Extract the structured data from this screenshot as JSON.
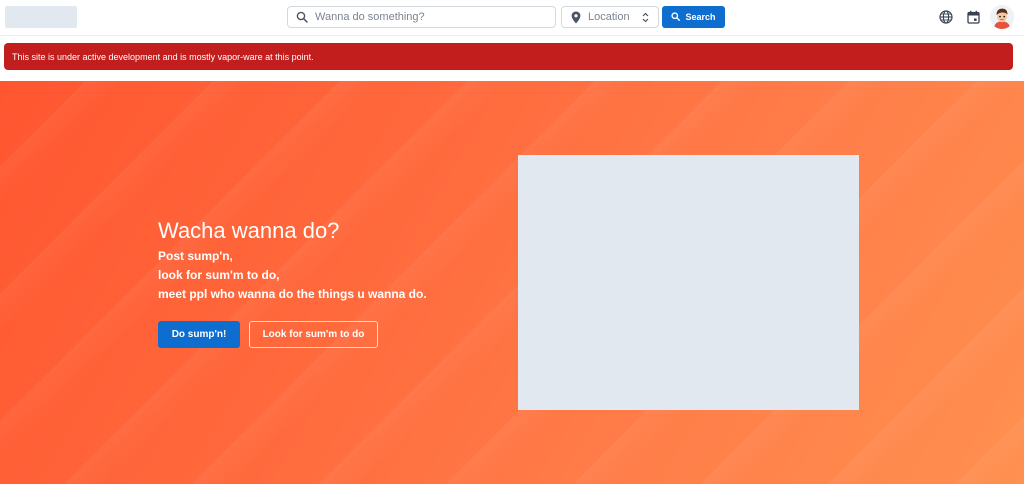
{
  "header": {
    "search": {
      "placeholder": "Wanna do something?",
      "value": ""
    },
    "location": {
      "placeholder": "Location"
    },
    "search_button_label": "Search",
    "icons": {
      "search": "search-icon",
      "location": "map-pin-icon",
      "select": "chevron-up-down-icon",
      "language": "globe-icon",
      "calendar": "calendar-icon",
      "avatar": "user-avatar"
    }
  },
  "alert": {
    "message": "This site is under active development and is mostly vapor-ware at this point.",
    "color": "#c31e1e"
  },
  "hero": {
    "title": "Wacha wanna do?",
    "lines": [
      "Post sump'n,",
      "look for sum'm to do,",
      "meet ppl who wanna do the things u wanna do."
    ],
    "primary_button": "Do sump'n!",
    "secondary_button": "Look for sum'm to do",
    "gradient_colors": [
      "#ff5630",
      "#ff9050"
    ]
  },
  "colors": {
    "accent": "#0d6ecf",
    "image_placeholder": "#e2e8f0"
  }
}
